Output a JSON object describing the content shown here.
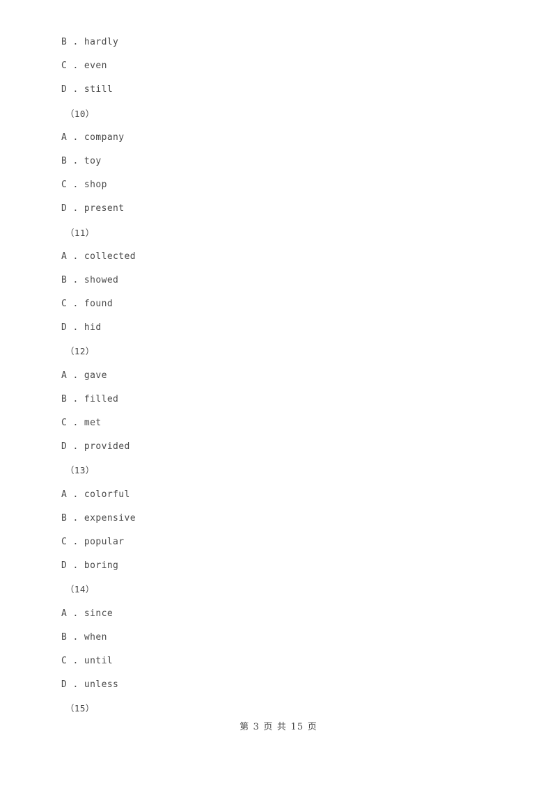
{
  "document": {
    "kind": "exam-paper-page",
    "page_background": "#ffffff",
    "text_color": "#4a4a4a"
  },
  "body_lines": [
    {
      "type": "option",
      "text": "B . hardly"
    },
    {
      "type": "option",
      "text": "C . even"
    },
    {
      "type": "option",
      "text": "D . still"
    },
    {
      "type": "qnum",
      "text": "（10）"
    },
    {
      "type": "option",
      "text": "A . company"
    },
    {
      "type": "option",
      "text": "B . toy"
    },
    {
      "type": "option",
      "text": "C . shop"
    },
    {
      "type": "option",
      "text": "D . present"
    },
    {
      "type": "qnum",
      "text": "（11）"
    },
    {
      "type": "option",
      "text": "A . collected"
    },
    {
      "type": "option",
      "text": "B . showed"
    },
    {
      "type": "option",
      "text": "C . found"
    },
    {
      "type": "option",
      "text": "D . hid"
    },
    {
      "type": "qnum",
      "text": "（12）"
    },
    {
      "type": "option",
      "text": "A . gave"
    },
    {
      "type": "option",
      "text": "B . filled"
    },
    {
      "type": "option",
      "text": "C . met"
    },
    {
      "type": "option",
      "text": "D . provided"
    },
    {
      "type": "qnum",
      "text": "（13）"
    },
    {
      "type": "option",
      "text": "A . colorful"
    },
    {
      "type": "option",
      "text": "B . expensive"
    },
    {
      "type": "option",
      "text": "C . popular"
    },
    {
      "type": "option",
      "text": "D . boring"
    },
    {
      "type": "qnum",
      "text": "（14）"
    },
    {
      "type": "option",
      "text": "A . since"
    },
    {
      "type": "option",
      "text": "B . when"
    },
    {
      "type": "option",
      "text": "C . until"
    },
    {
      "type": "option",
      "text": "D . unless"
    },
    {
      "type": "qnum",
      "text": "（15）"
    }
  ],
  "footer": {
    "text": "第 3 页 共 15 页",
    "current_page": "3",
    "total_pages": "15"
  }
}
